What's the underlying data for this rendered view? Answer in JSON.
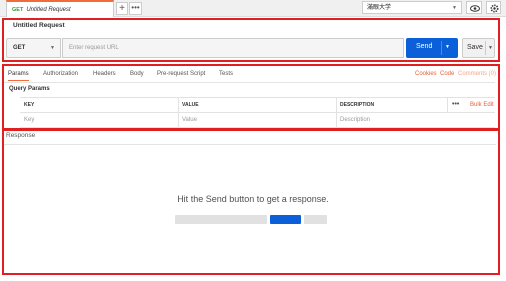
{
  "tab": {
    "method": "GET",
    "title": "Untitled Request",
    "add": "+",
    "more": "•••"
  },
  "environment": {
    "selected": "滿眼大学",
    "eye_icon": "eye-icon",
    "gear_icon": "gear-icon"
  },
  "request": {
    "title": "Untitled Request",
    "method": "GET",
    "url_placeholder": "Enter request URL",
    "send_label": "Send",
    "save_label": "Save"
  },
  "param_tabs": [
    "Params",
    "Authorization",
    "Headers",
    "Body",
    "Pre-request Script",
    "Tests"
  ],
  "right_links": {
    "cookies": "Cookies",
    "code": "Code",
    "comments": "Comments (0)"
  },
  "query_params": {
    "title": "Query Params",
    "headers": {
      "key": "KEY",
      "value": "VALUE",
      "description": "DESCRIPTION"
    },
    "more": "•••",
    "bulk_edit": "Bulk Edit",
    "placeholders": {
      "key": "Key",
      "value": "Value",
      "description": "Description"
    }
  },
  "response": {
    "title": "Response",
    "hint": "Hit the Send button to get a response."
  },
  "colors": {
    "accent": "#f26b3a",
    "send": "#0b5fd9",
    "highlight_box": "#e02020"
  }
}
